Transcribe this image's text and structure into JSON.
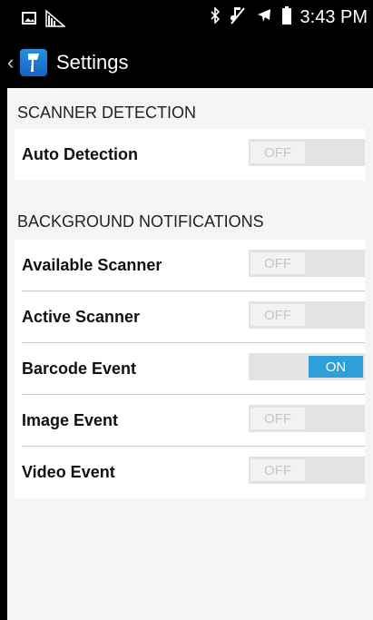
{
  "status_bar": {
    "time": "3:43 PM",
    "icons": [
      "image-icon",
      "signal-icon",
      "bluetooth-icon",
      "mute-icon",
      "airplane-icon",
      "battery-icon"
    ]
  },
  "action_bar": {
    "title": "Settings",
    "back_icon": "chevron-left-icon",
    "app_icon": "scanner-icon"
  },
  "sections": [
    {
      "header": "SCANNER DETECTION",
      "items": [
        {
          "label": "Auto Detection",
          "state": "OFF"
        }
      ]
    },
    {
      "header": "BACKGROUND NOTIFICATIONS",
      "items": [
        {
          "label": "Available Scanner",
          "state": "OFF"
        },
        {
          "label": "Active Scanner",
          "state": "OFF"
        },
        {
          "label": "Barcode Event",
          "state": "ON"
        },
        {
          "label": "Image Event",
          "state": "OFF"
        },
        {
          "label": "Video Event",
          "state": "OFF"
        }
      ]
    }
  ],
  "colors": {
    "toggle_on": "#2e9fd9",
    "toggle_track": "#e3e3e3",
    "background": "#f5f5f5"
  }
}
